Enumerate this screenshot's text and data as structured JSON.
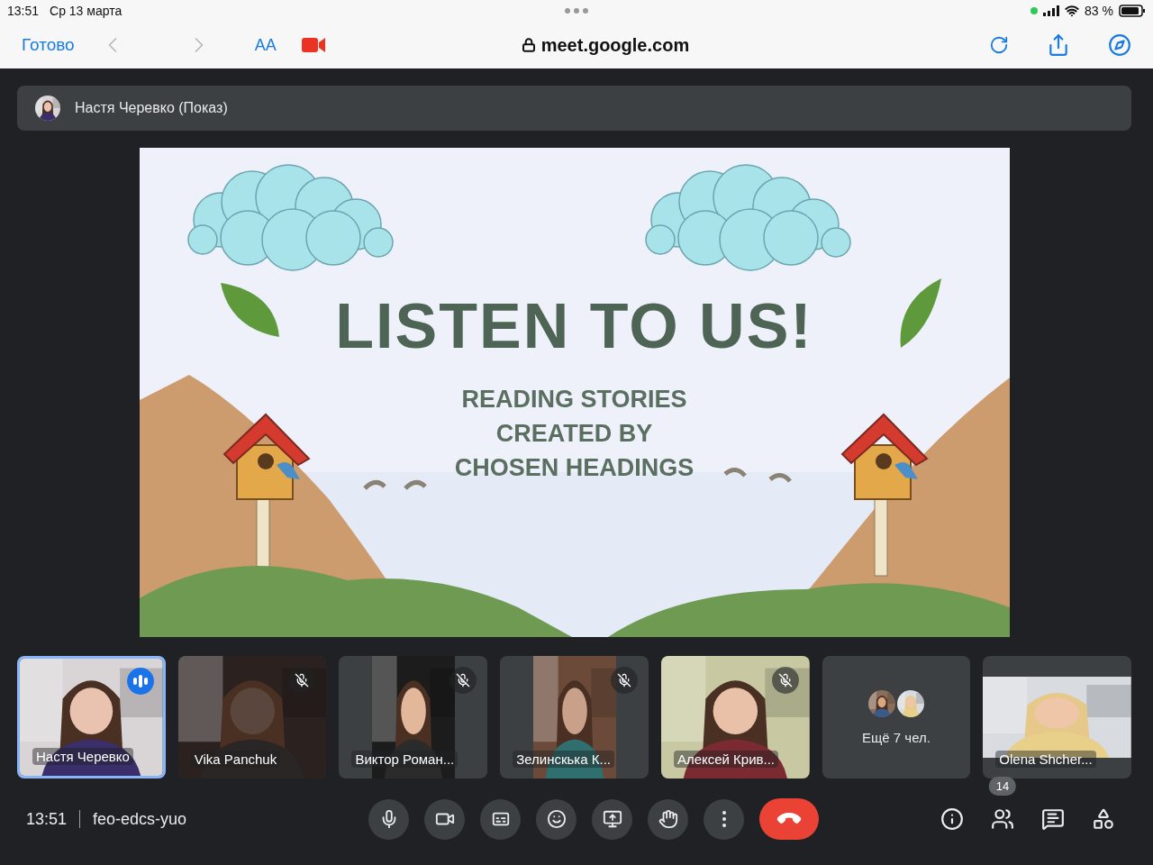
{
  "status_bar": {
    "time": "13:51",
    "date": "Ср 13 марта",
    "camera_in_use": true,
    "battery": "83 %"
  },
  "browser": {
    "done": "Готово",
    "nav": [
      {
        "kind": "back",
        "disabled": true
      },
      {
        "kind": "forward",
        "disabled": true
      }
    ],
    "text_size": "AA",
    "url": "meet.google.com"
  },
  "presenter": {
    "name": "Настя Черевко (Показ)"
  },
  "slide": {
    "title": "LISTEN TO US!",
    "subtitle_lines": [
      "READING STORIES",
      "CREATED BY",
      "CHOSEN HEADINGS"
    ]
  },
  "tiles": [
    {
      "kind": "video",
      "name": "Настя Черевко",
      "selected": true,
      "speaking": true,
      "muted": false,
      "pillarbox": false,
      "letterbox": false
    },
    {
      "kind": "video",
      "name": "Vika Panchuk",
      "selected": false,
      "speaking": false,
      "muted": true,
      "pillarbox": false,
      "letterbox": false
    },
    {
      "kind": "video",
      "name": "Виктор Роман...",
      "selected": false,
      "speaking": false,
      "muted": true,
      "pillarbox": true,
      "letterbox": false
    },
    {
      "kind": "video",
      "name": "Зелинскька К...",
      "selected": false,
      "speaking": false,
      "muted": true,
      "pillarbox": true,
      "letterbox": false
    },
    {
      "kind": "video",
      "name": "Алексей Крив...",
      "selected": false,
      "speaking": false,
      "muted": true,
      "pillarbox": false,
      "letterbox": false
    },
    {
      "kind": "more",
      "name": "Ещё 7 чел.",
      "selected": false
    },
    {
      "kind": "video",
      "name": "Olena Shcher...",
      "selected": false,
      "speaking": false,
      "muted": false,
      "pillarbox": false,
      "letterbox": true
    }
  ],
  "meeting": {
    "time": "13:51",
    "code": "feo-edcs-yuo"
  },
  "controls": [
    {
      "kind": "mic"
    },
    {
      "kind": "camera"
    },
    {
      "kind": "captions"
    },
    {
      "kind": "emoji"
    },
    {
      "kind": "present"
    },
    {
      "kind": "hand"
    },
    {
      "kind": "more"
    },
    {
      "kind": "end"
    }
  ],
  "side_controls": [
    {
      "kind": "info"
    },
    {
      "kind": "people",
      "badge": "14"
    },
    {
      "kind": "chat"
    },
    {
      "kind": "activities"
    }
  ]
}
